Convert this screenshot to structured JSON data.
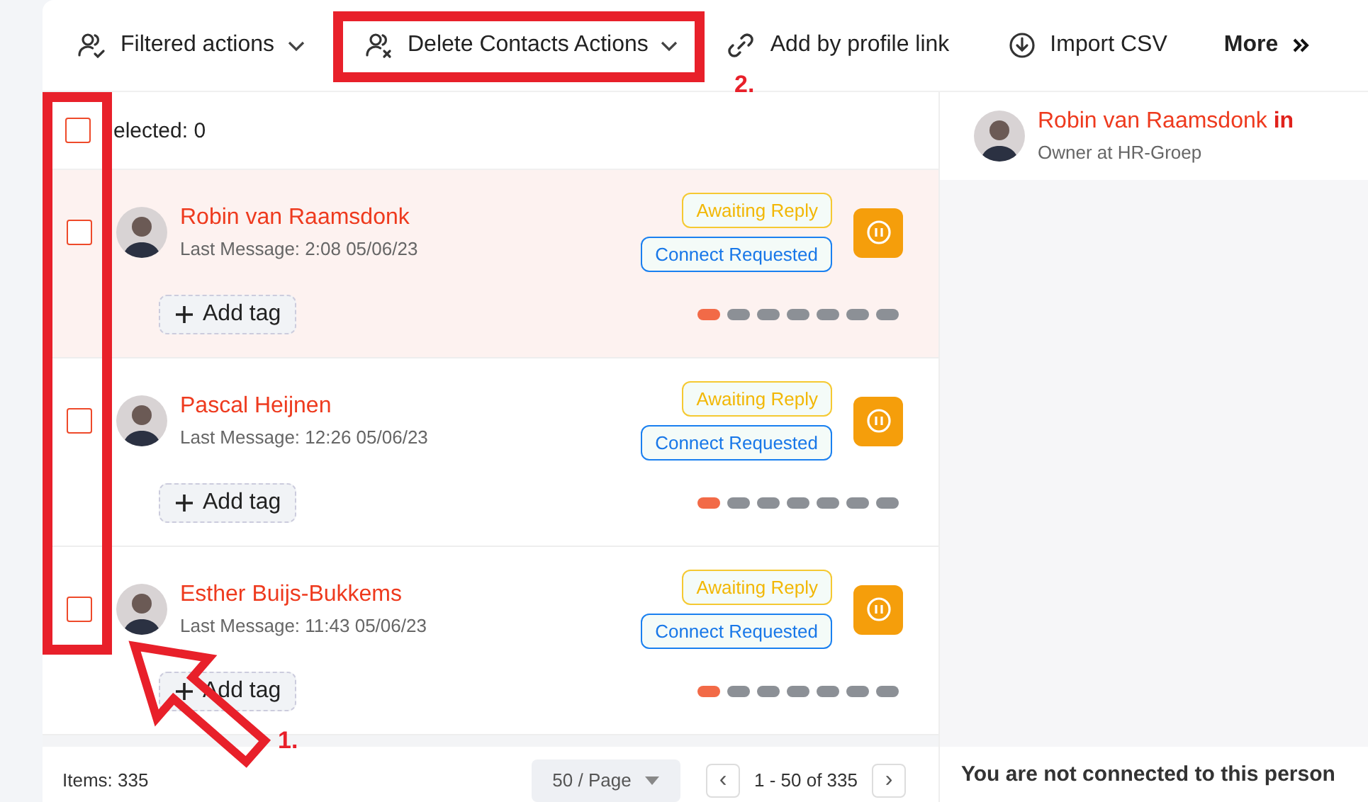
{
  "toolbar": [
    {
      "kind": "users-check",
      "label": "Filtered actions",
      "dropdown": true
    },
    {
      "kind": "users-x",
      "label": "Delete Contacts Actions",
      "dropdown": true
    },
    {
      "kind": "link",
      "label": "Add by profile link",
      "dropdown": false
    },
    {
      "kind": "import",
      "label": "Import CSV",
      "dropdown": false
    },
    {
      "kind": "more",
      "label": "More",
      "dropdown": false
    }
  ],
  "list_header": {
    "checked": false,
    "label": "elected: 0"
  },
  "contacts": [
    {
      "name": "Robin van Raamsdonk",
      "last_message": "Last Message: 2:08 05/06/23",
      "checked": false,
      "selected": true,
      "tags": [
        "Awaiting Reply",
        "Connect Requested"
      ],
      "add_tag": "Add tag",
      "steps": [
        true,
        false,
        false,
        false,
        false,
        false,
        false
      ]
    },
    {
      "name": "Pascal Heijnen",
      "last_message": "Last Message: 12:26 05/06/23",
      "checked": false,
      "selected": false,
      "tags": [
        "Awaiting Reply",
        "Connect Requested"
      ],
      "add_tag": "Add tag",
      "steps": [
        true,
        false,
        false,
        false,
        false,
        false,
        false
      ]
    },
    {
      "name": "Esther Buijs-Bukkems",
      "last_message": "Last Message: 11:43 05/06/23",
      "checked": false,
      "selected": false,
      "tags": [
        "Awaiting Reply",
        "Connect Requested"
      ],
      "add_tag": "Add tag",
      "steps": [
        true,
        false,
        false,
        false,
        false,
        false,
        false
      ]
    }
  ],
  "footer": {
    "items": "Items: 335",
    "page_size": "50 / Page",
    "range": "1 - 50 of 335",
    "prev": "‹",
    "next": "›"
  },
  "profile": {
    "name": "Robin van Raamsdonk",
    "badge": "in",
    "headline": "Owner at HR-Groep",
    "notice": "You are not connected to this person"
  },
  "annotations": [
    {
      "kind": "frame-arrow",
      "label": "1."
    },
    {
      "kind": "frame",
      "label": "2."
    }
  ]
}
